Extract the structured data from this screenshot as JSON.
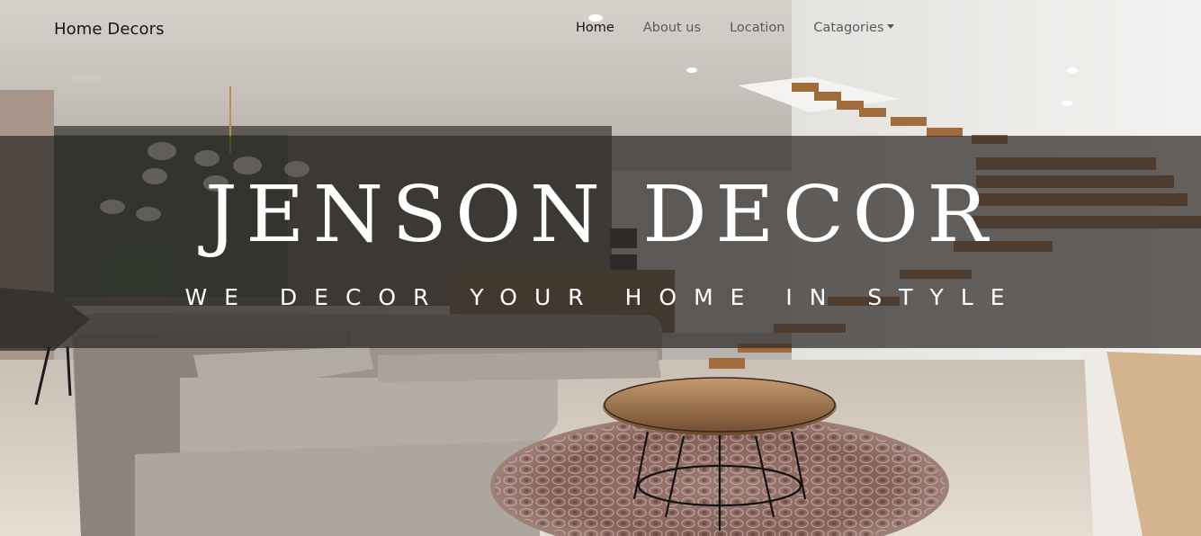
{
  "navbar": {
    "brand": "Home Decors",
    "links": {
      "home": "Home",
      "about": "About us",
      "location": "Location",
      "categories": "Catagories"
    }
  },
  "hero": {
    "title": "JENSON DECOR",
    "subtitle": "WE DECOR YOUR HOME IN STYLE"
  },
  "colors": {
    "band_overlay": "#302c2a",
    "hero_text": "#ffffff",
    "nav_text": "#5a5a5a",
    "nav_active": "#161616"
  },
  "icons": [
    "dropdown-caret-icon"
  ]
}
